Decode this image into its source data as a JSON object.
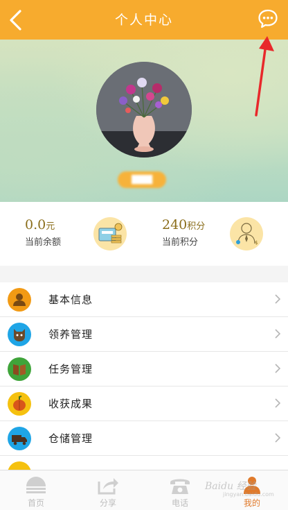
{
  "header": {
    "title": "个人中心",
    "back_icon": "chevron-left-icon",
    "chat_icon": "chat-bubble-icon",
    "color": "#f7ab2e"
  },
  "profile": {
    "username": "▇▇▇"
  },
  "stats": {
    "balance": {
      "value": "0.0",
      "unit": "元",
      "label": "当前余额",
      "icon": "wallet-cash-icon"
    },
    "points": {
      "value": "240",
      "unit": "积分",
      "label": "当前积分",
      "icon": "person-points-icon"
    }
  },
  "menu": {
    "items": [
      {
        "label": "基本信息",
        "icon": "person-icon",
        "color": "#f29a14"
      },
      {
        "label": "领养管理",
        "icon": "animal-icon",
        "color": "#1fa5e6"
      },
      {
        "label": "任务管理",
        "icon": "book-icon",
        "color": "#3fa43a"
      },
      {
        "label": "收获成果",
        "icon": "pumpkin-icon",
        "color": "#f5c10f"
      },
      {
        "label": "仓储管理",
        "icon": "truck-icon",
        "color": "#1fa5e6"
      },
      {
        "label": "",
        "icon": "more-icon",
        "color": "#f5c10f"
      }
    ]
  },
  "tabbar": {
    "tabs": [
      {
        "label": "首页",
        "icon": "home-icon"
      },
      {
        "label": "分享",
        "icon": "share-icon"
      },
      {
        "label": "电话",
        "icon": "phone-icon"
      },
      {
        "label": "我的",
        "icon": "user-icon"
      }
    ],
    "active_index": 3,
    "active_color": "#e07a2b"
  },
  "watermark": {
    "text": "Baidu 经验",
    "sub": "jingyan.baidu.com"
  }
}
